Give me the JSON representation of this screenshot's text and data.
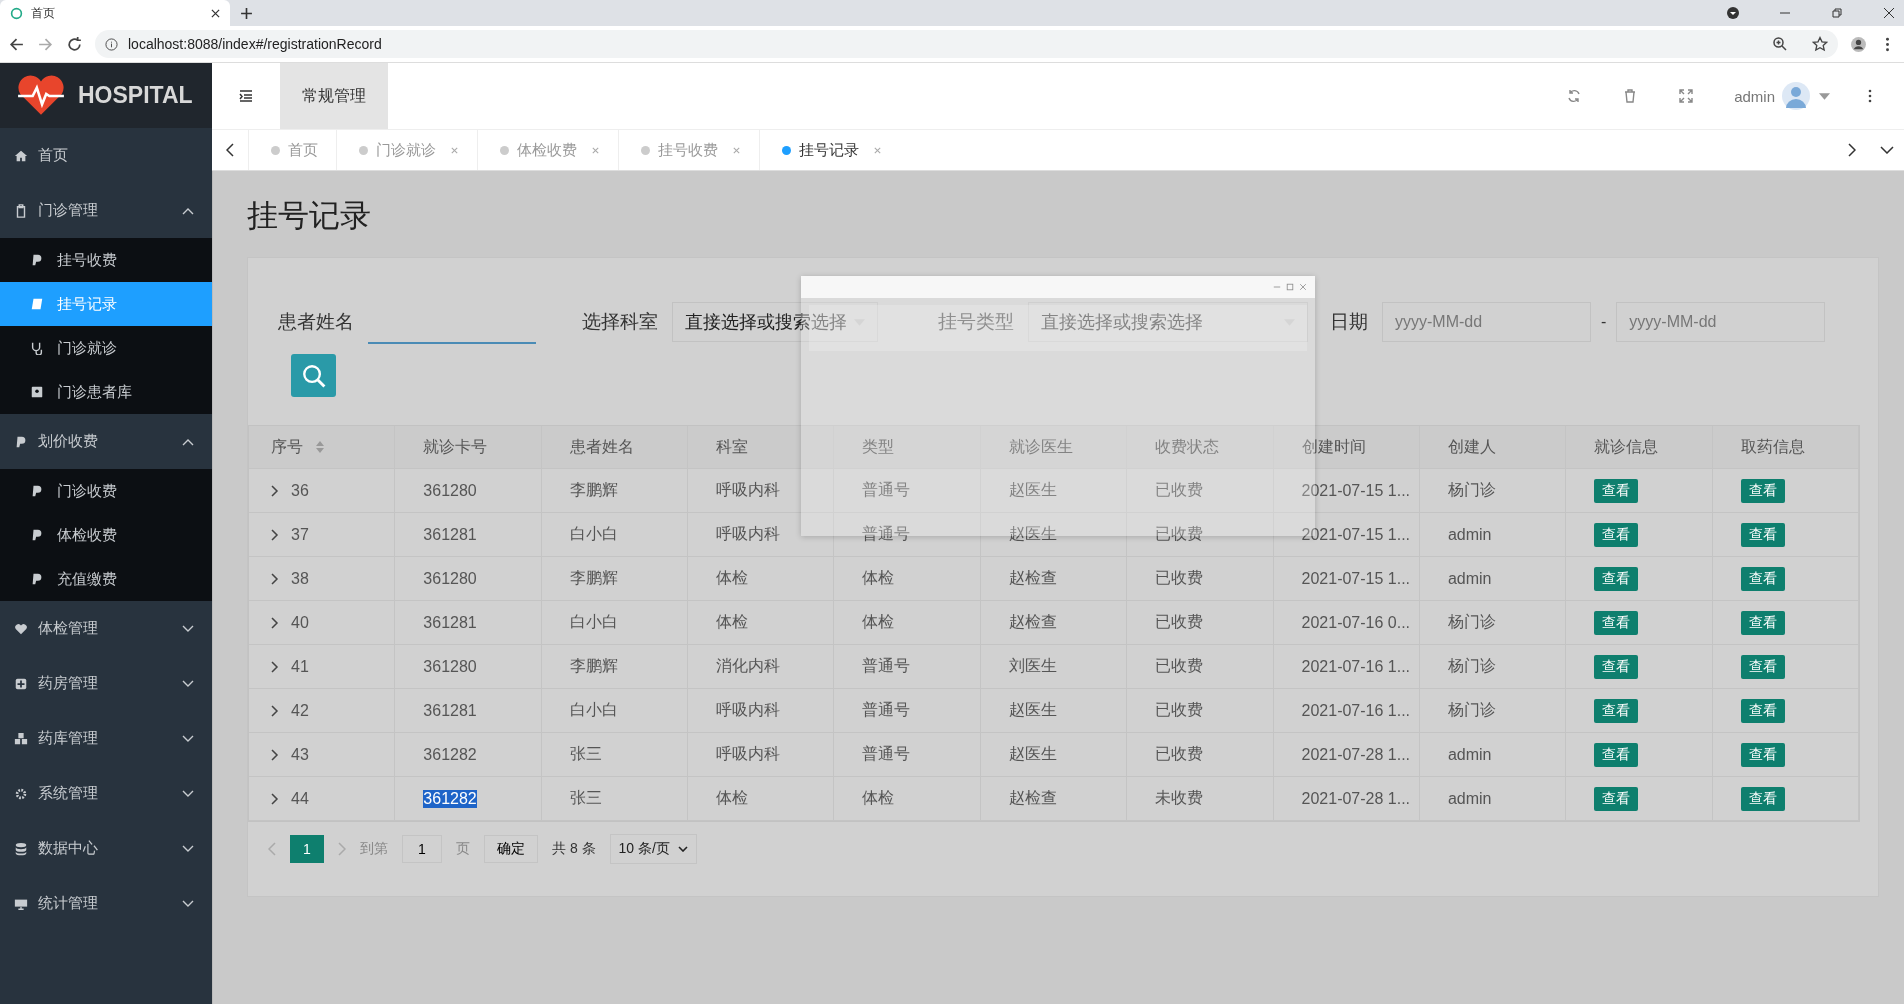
{
  "browser": {
    "tab_title": "首页",
    "address": "localhost:8088/index#/registrationRecord"
  },
  "brand": "HOSPITAL",
  "sidebar": [
    {
      "label": "首页",
      "selected": false
    },
    {
      "label": "门诊管理",
      "selected": false,
      "expanded": true,
      "children": [
        {
          "label": "挂号收费",
          "selected": false
        },
        {
          "label": "挂号记录",
          "selected": true
        },
        {
          "label": "门诊就诊",
          "selected": false
        },
        {
          "label": "门诊患者库",
          "selected": false
        }
      ]
    },
    {
      "label": "划价收费",
      "selected": false,
      "expanded": true,
      "children": [
        {
          "label": "门诊收费",
          "selected": false
        },
        {
          "label": "体检收费",
          "selected": false
        },
        {
          "label": "充值缴费",
          "selected": false
        }
      ]
    },
    {
      "label": "体检管理",
      "selected": false,
      "expanded": false
    },
    {
      "label": "药房管理",
      "selected": false,
      "expanded": false
    },
    {
      "label": "药库管理",
      "selected": false,
      "expanded": false
    },
    {
      "label": "系统管理",
      "selected": false,
      "expanded": false
    },
    {
      "label": "数据中心",
      "selected": false,
      "expanded": false
    },
    {
      "label": "统计管理",
      "selected": false,
      "expanded": false
    }
  ],
  "top_nav": [
    {
      "label": "常规管理",
      "selected": true
    }
  ],
  "user": "admin",
  "tabs": [
    {
      "label": "首页",
      "selected": false,
      "closable": false
    },
    {
      "label": "门诊就诊",
      "selected": false,
      "closable": true
    },
    {
      "label": "体检收费",
      "selected": false,
      "closable": true
    },
    {
      "label": "挂号收费",
      "selected": false,
      "closable": true
    },
    {
      "label": "挂号记录",
      "selected": true,
      "closable": true
    }
  ],
  "page_title": "挂号记录",
  "filters": [
    {
      "kind": "text",
      "label": "患者姓名"
    },
    {
      "kind": "select",
      "label": "选择科室",
      "placeholder": "直接选择或搜索选择"
    },
    {
      "kind": "select",
      "label": "挂号类型",
      "placeholder": "直接选择或搜索选择"
    },
    {
      "kind": "daterange",
      "label": "日期",
      "start_placeholder": "yyyy-MM-dd",
      "separator": "-",
      "end_placeholder": "yyyy-MM-dd"
    }
  ],
  "table": {
    "columns": [
      "序号",
      "就诊卡号",
      "患者姓名",
      "科室",
      "类型",
      "就诊医生",
      "收费状态",
      "创建时间",
      "创建人",
      "就诊信息",
      "取药信息"
    ],
    "rows": [
      {
        "cells": [
          "36",
          "361280",
          "李鹏辉",
          "呼吸内科",
          "普通号",
          "赵医生",
          "已收费",
          "2021-07-15 1...",
          "杨门诊"
        ],
        "actions": [
          "查看",
          "查看"
        ],
        "highlighted": false
      },
      {
        "cells": [
          "37",
          "361281",
          "白小白",
          "呼吸内科",
          "普通号",
          "赵医生",
          "已收费",
          "2021-07-15 1...",
          "admin"
        ],
        "actions": [
          "查看",
          "查看"
        ],
        "highlighted": false
      },
      {
        "cells": [
          "38",
          "361280",
          "李鹏辉",
          "体检",
          "体检",
          "赵检查",
          "已收费",
          "2021-07-15 1...",
          "admin"
        ],
        "actions": [
          "查看",
          "查看"
        ],
        "highlighted": false
      },
      {
        "cells": [
          "40",
          "361281",
          "白小白",
          "体检",
          "体检",
          "赵检查",
          "已收费",
          "2021-07-16 0...",
          "杨门诊"
        ],
        "actions": [
          "查看",
          "查看"
        ],
        "highlighted": false
      },
      {
        "cells": [
          "41",
          "361280",
          "李鹏辉",
          "消化内科",
          "普通号",
          "刘医生",
          "已收费",
          "2021-07-16 1...",
          "杨门诊"
        ],
        "actions": [
          "查看",
          "查看"
        ],
        "highlighted": false
      },
      {
        "cells": [
          "42",
          "361281",
          "白小白",
          "呼吸内科",
          "普通号",
          "赵医生",
          "已收费",
          "2021-07-16 1...",
          "杨门诊"
        ],
        "actions": [
          "查看",
          "查看"
        ],
        "highlighted": false
      },
      {
        "cells": [
          "43",
          "361282",
          "张三",
          "呼吸内科",
          "普通号",
          "赵医生",
          "已收费",
          "2021-07-28 1...",
          "admin"
        ],
        "actions": [
          "查看",
          "查看"
        ],
        "highlighted": false
      },
      {
        "cells": [
          "44",
          "361282",
          "张三",
          "体检",
          "体检",
          "赵检查",
          "未收费",
          "2021-07-28 1...",
          "admin"
        ],
        "actions": [
          "查看",
          "查看"
        ],
        "highlighted": true
      }
    ]
  },
  "pagination": {
    "pages": [
      {
        "label": "1",
        "selected": true
      }
    ],
    "goto_label": "到第",
    "goto_value": "1",
    "page_unit": "页",
    "confirm": "确定",
    "total": "共 8 条",
    "page_size": "10 条/页"
  }
}
